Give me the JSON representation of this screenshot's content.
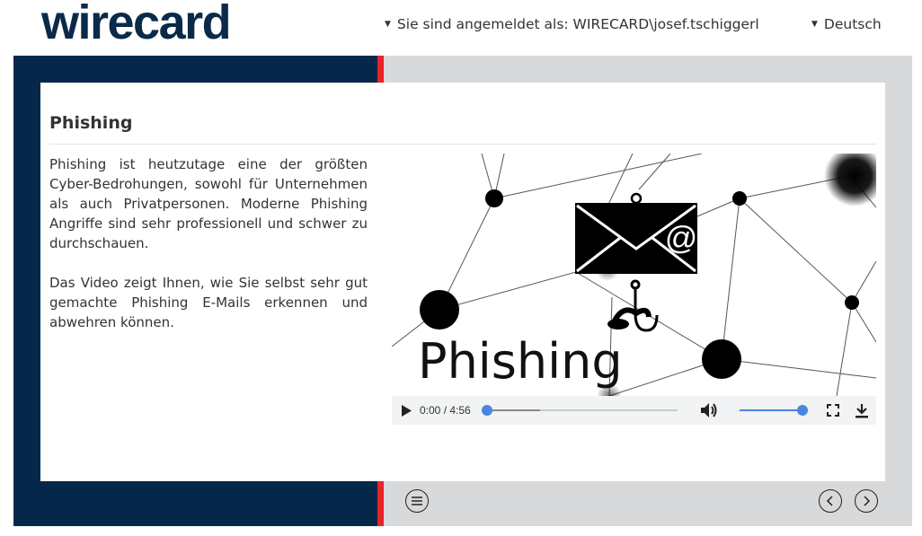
{
  "header": {
    "logo_text": "wirecard",
    "user_label": "Sie sind angemeldet als: WIRECARD\\josef.tschiggerl",
    "language_label": "Deutsch"
  },
  "lesson": {
    "title": "Phishing",
    "paragraphs": [
      "Phishing ist heutzutage eine der größten Cyber-Bedrohungen, sowohl für Unternehmen als auch Privatpersonen. Moderne Phishing Angriffe sind sehr professionell und schwer zu durchschauen.",
      "Das Video zeigt Ihnen, wie Sie selbst sehr gut gemachte Phishing E-Mails erkennen und abwehren können."
    ]
  },
  "video": {
    "poster_text": "Phishing",
    "poster_at_symbol": "@",
    "time_display": "0:00 / 4:56",
    "progress_buffered": 0.28,
    "progress_played": 0.0,
    "volume_level": 1.0
  },
  "colors": {
    "brand_navy": "#05284a",
    "accent_red": "#e8232a",
    "panel_gray": "#d8d9db",
    "player_blue": "#4a85e0"
  },
  "icons": {
    "user_caret": "caret-down-icon",
    "language_caret": "caret-down-icon",
    "menu": "menu-circle-icon",
    "previous": "chevron-left-circle-icon",
    "next": "chevron-right-circle-icon"
  }
}
